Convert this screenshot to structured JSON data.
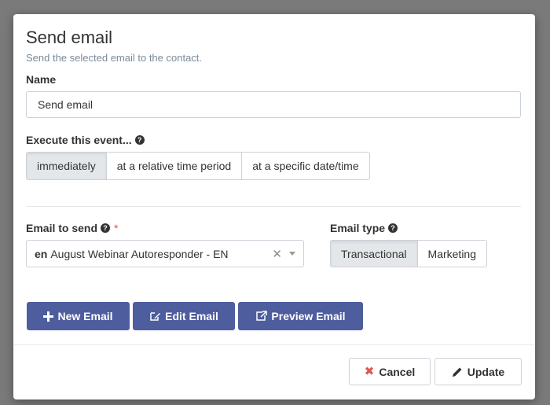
{
  "modal": {
    "title": "Send email",
    "subtitle": "Send the selected email to the contact."
  },
  "name_field": {
    "label": "Name",
    "value": "Send email"
  },
  "execute": {
    "label": "Execute this event...",
    "options": [
      "immediately",
      "at a relative time period",
      "at a specific date/time"
    ],
    "selected": "immediately"
  },
  "email_to_send": {
    "label": "Email to send",
    "required_mark": "*",
    "language": "en",
    "value": "August Webinar Autoresponder - EN",
    "clear_glyph": "✕"
  },
  "email_type": {
    "label": "Email type",
    "options": [
      "Transactional",
      "Marketing"
    ],
    "selected": "Transactional"
  },
  "actions": {
    "new_email": "New Email",
    "edit_email": "Edit Email",
    "preview_email": "Preview Email"
  },
  "footer": {
    "cancel": "Cancel",
    "update": "Update"
  },
  "icons": {
    "help": "question-circle-icon",
    "plus": "plus-icon",
    "edit": "edit-icon",
    "external": "external-link-icon",
    "cancel": "times-icon",
    "update": "pencil-icon"
  },
  "colors": {
    "primary_button": "#4e5d9d",
    "required": "#e0554f",
    "cancel_icon": "#e0554f",
    "active_segment": "#e4e7ea",
    "backdrop": "#7a7a7a"
  }
}
